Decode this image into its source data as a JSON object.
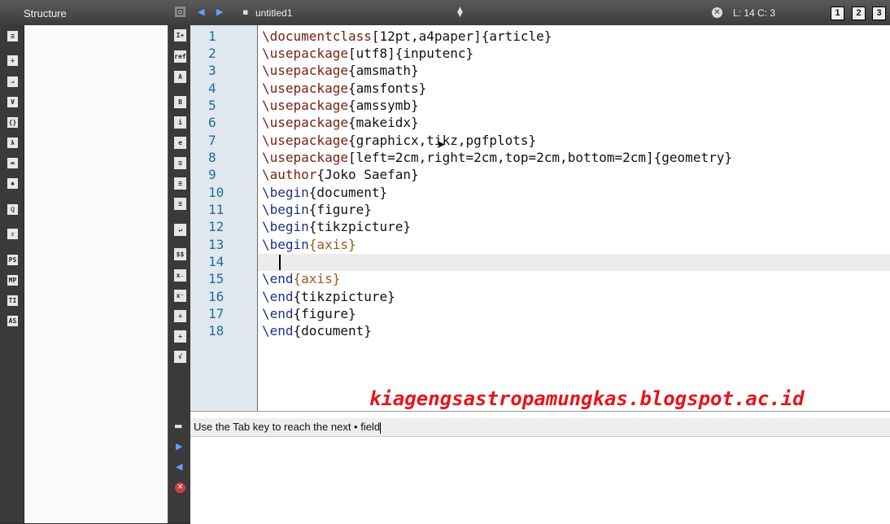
{
  "structure_panel": {
    "title": "Structure"
  },
  "toolbar": {
    "filename": "untitled1",
    "cursor_position": "L: 14 C: 3",
    "view_buttons": [
      "1",
      "2",
      "3"
    ]
  },
  "left_icons": [
    "≡",
    "÷",
    "⇒",
    "∀",
    "{}",
    "λ",
    "∞",
    "✱",
    "ℚ",
    "⌅",
    "PS",
    "MP",
    "TI",
    "AS"
  ],
  "editor_icons": [
    "I+",
    "ref",
    "A",
    "B",
    "i",
    "e",
    "≡",
    "≡",
    "≡",
    "↵",
    "$$",
    "x₋",
    "x⁻",
    "÷",
    "÷",
    "√"
  ],
  "line_numbers": [
    "1",
    "2",
    "3",
    "4",
    "5",
    "6",
    "7",
    "8",
    "9",
    "10",
    "11",
    "12",
    "13",
    "14",
    "15",
    "16",
    "17",
    "18"
  ],
  "code": {
    "l1": {
      "cmd": "\\documentclass",
      "rest": "[12pt,a4paper]{article}"
    },
    "l2": {
      "cmd": "\\usepackage",
      "rest": "[utf8]{inputenc}"
    },
    "l3": {
      "cmd": "\\usepackage",
      "rest": "{amsmath}"
    },
    "l4": {
      "cmd": "\\usepackage",
      "rest": "{amsfonts}"
    },
    "l5": {
      "cmd": "\\usepackage",
      "rest": "{amssymb}"
    },
    "l6": {
      "cmd": "\\usepackage",
      "rest": "{makeidx}"
    },
    "l7": {
      "cmd": "\\usepackage",
      "rest": "{graphicx,tikz,pgfplots}"
    },
    "l8": {
      "cmd": "\\usepackage",
      "rest": "[left=2cm,right=2cm,top=2cm,bottom=2cm]{geometry}"
    },
    "l9": {
      "cmd": "\\author",
      "rest": "{Joko Saefan}"
    },
    "l10": {
      "cmd": "\\begin",
      "rest": "{document}"
    },
    "l11": {
      "cmd": "\\begin",
      "rest": "{figure}"
    },
    "l12": {
      "cmd": "\\begin",
      "rest": "{tikzpicture}"
    },
    "l13": {
      "cmd": "\\begin",
      "arg": "{axis}"
    },
    "l14": {
      "text": ""
    },
    "l15": {
      "cmd": "\\end",
      "arg": "{axis}"
    },
    "l16": {
      "cmd": "\\end",
      "rest": "{tikzpicture}"
    },
    "l17": {
      "cmd": "\\end",
      "rest": "{figure}"
    },
    "l18": {
      "cmd": "\\end",
      "rest": "{document}"
    }
  },
  "watermark": "kiagengsastropamungkas.blogspot.ac.id",
  "message": {
    "text": "Use the Tab key to reach the next • field"
  }
}
